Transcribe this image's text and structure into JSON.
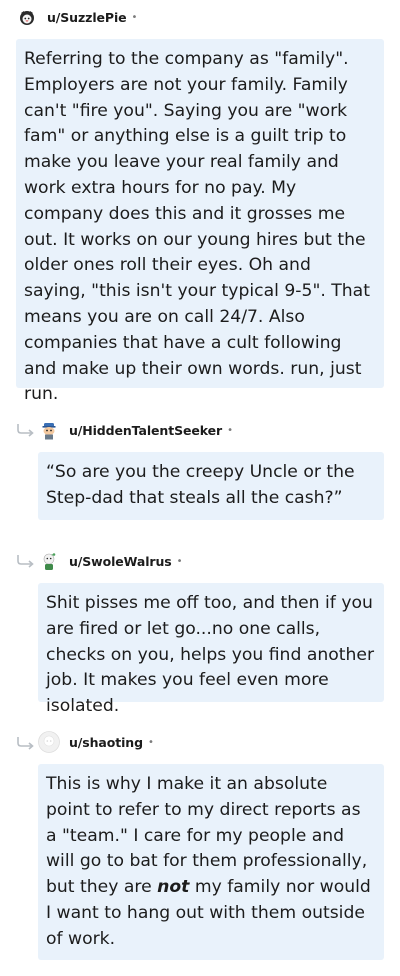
{
  "comments": [
    {
      "username": "u/SuzzlePie",
      "separator": "•",
      "body": "Referring to the company as \"family\". Employers are not your family. Family can't \"fire you\". Saying you are \"work fam\" or anything else is a guilt trip to make you leave your real family and work extra hours for no pay. My company does this and it grosses me out. It works on our young hires but the older ones roll their eyes. Oh and saying, \"this isn't your typical 9-5\". That means you are on call 24/7. Also companies that have a cult following and make up their own words. run, just run."
    },
    {
      "username": "u/HiddenTalentSeeker",
      "separator": "•",
      "body": "“So are you the creepy Uncle or the Step-dad that steals all the cash?”"
    },
    {
      "username": "u/SwoleWalrus",
      "separator": "•",
      "body": "Shit pisses me off too, and then if you are fired or let go...no one calls, checks on you, helps you find another job. It makes you feel even more isolated."
    },
    {
      "username": "u/shaoting",
      "separator": "•",
      "body_before": "This is why I make it an absolute point to refer to my direct reports as a \"team.\" I care for my people and will go to bat for them professionally, but they are ",
      "body_emphasis": "not",
      "body_after": " my family nor would I want to hang out with them outside of work."
    }
  ]
}
